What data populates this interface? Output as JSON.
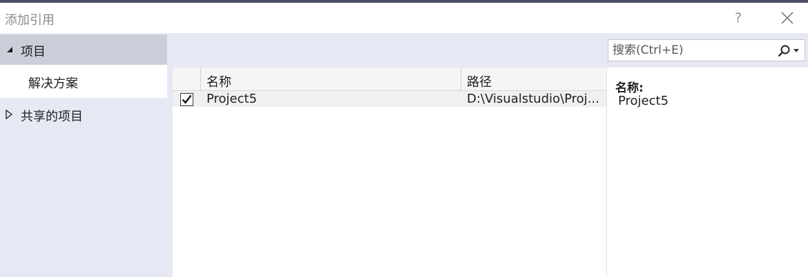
{
  "window": {
    "title": "添加引用",
    "help_label": "?"
  },
  "sidebar": {
    "items": [
      {
        "label": "项目",
        "expanded": true,
        "icon": "expanded-triangle-icon"
      },
      {
        "label": "解决方案",
        "selected": true
      },
      {
        "label": "共享的项目",
        "expanded": false,
        "icon": "collapsed-triangle-icon"
      }
    ]
  },
  "search": {
    "placeholder": "搜索(Ctrl+E)",
    "value": "",
    "icon": "search-icon"
  },
  "list": {
    "columns": [
      "名称",
      "路径"
    ],
    "rows": [
      {
        "checked": true,
        "name": "Project5",
        "path": "D:\\Visualstudio\\Proj..."
      }
    ]
  },
  "details": {
    "label": "名称:",
    "value": "Project5"
  },
  "colors": {
    "topbar": "#4a4c67",
    "sidebar_bg": "#e6e8f4",
    "selected_nav": "#cbcdd9"
  }
}
